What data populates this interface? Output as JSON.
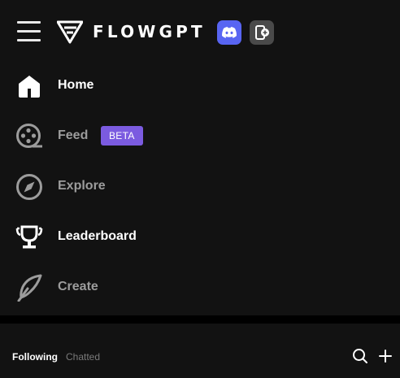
{
  "brand": {
    "name": "FLOWGPT",
    "accent": "#7b5be0",
    "discord_color": "#5865f2"
  },
  "header": {
    "menu_icon": "hamburger-icon",
    "discord_icon": "discord-icon",
    "add_app_icon": "add-app-icon"
  },
  "nav": {
    "items": [
      {
        "label": "Home",
        "icon": "home-icon",
        "active": true
      },
      {
        "label": "Feed",
        "icon": "film-reel-icon",
        "badge": "BETA",
        "active": false
      },
      {
        "label": "Explore",
        "icon": "compass-icon",
        "active": false
      },
      {
        "label": "Leaderboard",
        "icon": "trophy-icon",
        "active": true
      },
      {
        "label": "Create",
        "icon": "feather-icon",
        "active": false
      }
    ]
  },
  "chats": {
    "tabs": [
      {
        "label": "Following",
        "selected": true
      },
      {
        "label": "Chatted",
        "selected": false
      }
    ],
    "search_icon": "search-icon",
    "add_icon": "plus-icon"
  }
}
